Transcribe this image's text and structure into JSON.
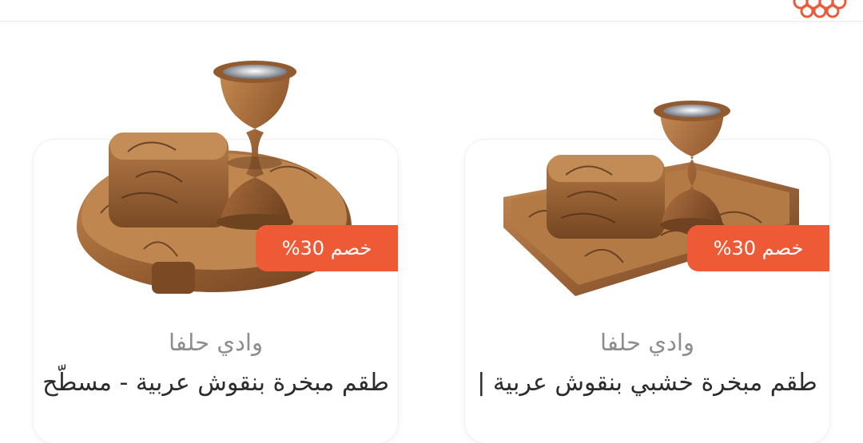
{
  "header": {
    "logo_icon": "brand-logo-icon",
    "accent_color": "#e85c3d"
  },
  "products": [
    {
      "discount": "خصم 30%",
      "brand": "وادي حلفا",
      "title": "طقم مبخرة بنقوش عربية - مسطّح"
    },
    {
      "discount": "خصم 30%",
      "brand": "وادي حلفا",
      "title": "طقم مبخرة خشبي بنقوش عربية |"
    }
  ],
  "colors": {
    "badge": "#ef5a36",
    "brand_text": "#8d8d8d",
    "title_text": "#2c2c2c"
  }
}
